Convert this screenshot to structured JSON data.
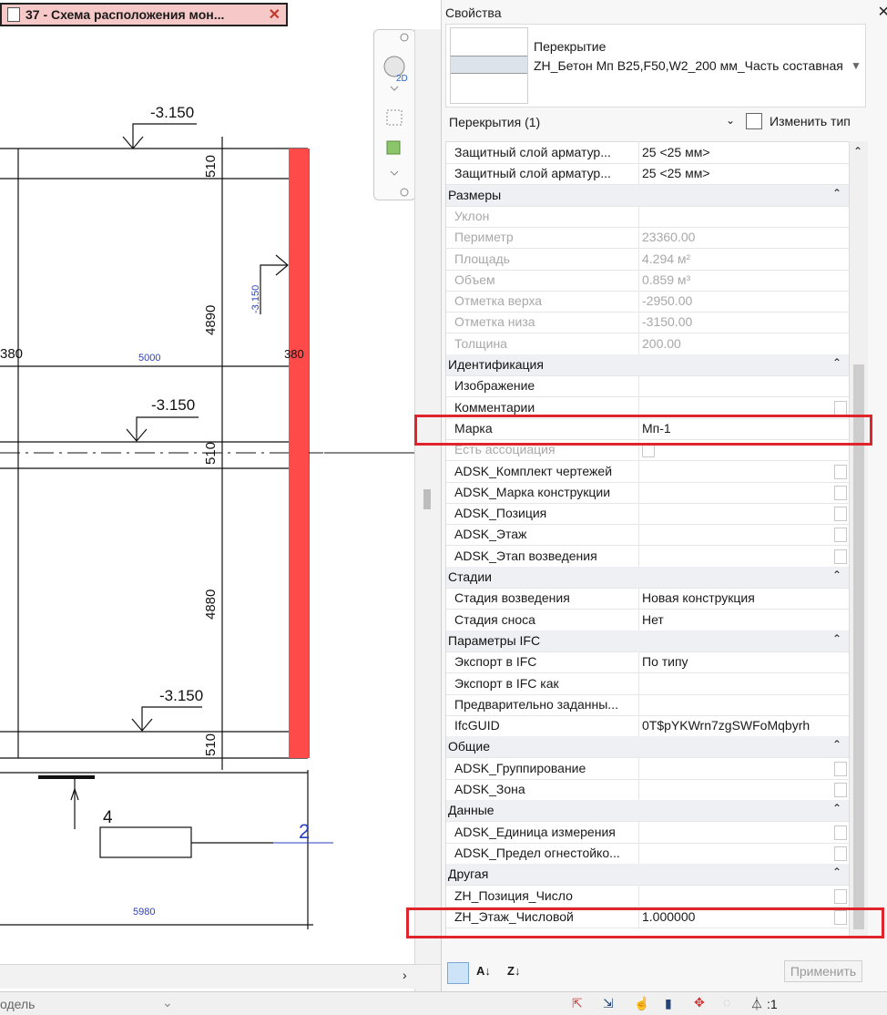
{
  "doc_tab": {
    "title": "37 - Схема расположения мон...",
    "close": "✕"
  },
  "drawing": {
    "elevation_labels": [
      "-3.150",
      "-3.150",
      "-3.150"
    ],
    "vertical_elev": "-3.150",
    "dims": [
      "510",
      "4890",
      "510",
      "4880",
      "510"
    ],
    "dim_blue": [
      "5000",
      "5980"
    ],
    "side_dims": [
      "380",
      "380"
    ],
    "tag_number": "4",
    "marker": "2"
  },
  "props": {
    "title": "Свойства",
    "close": "✕",
    "type_line1": "Перекрытие",
    "type_line2": "ZH_Бетон Мп В25,F50,W2_200 мм_Часть составная",
    "filter_label": "Перекрытия (1)",
    "edit_type": "Изменить тип",
    "apply": "Применить",
    "rows": [
      {
        "kind": "param",
        "label": "Защитный слой арматур...",
        "value": "25 <25 мм>"
      },
      {
        "kind": "param",
        "label": "Защитный слой арматур...",
        "value": "25 <25 мм>"
      },
      {
        "kind": "group",
        "label": "Размеры"
      },
      {
        "kind": "dim",
        "label": "Уклон",
        "value": ""
      },
      {
        "kind": "dim",
        "label": "Периметр",
        "value": "23360.00"
      },
      {
        "kind": "dim",
        "label": "Площадь",
        "value": "4.294 м²"
      },
      {
        "kind": "dim",
        "label": "Объем",
        "value": "0.859 м³"
      },
      {
        "kind": "dim",
        "label": "Отметка верха",
        "value": "-2950.00"
      },
      {
        "kind": "dim",
        "label": "Отметка низа",
        "value": "-3150.00"
      },
      {
        "kind": "dim",
        "label": "Толщина",
        "value": "200.00"
      },
      {
        "kind": "group",
        "label": "Идентификация"
      },
      {
        "kind": "param",
        "label": "Изображение",
        "value": ""
      },
      {
        "kind": "cb",
        "label": "Комментарии",
        "value": ""
      },
      {
        "kind": "param",
        "label": "Марка",
        "value": "Мп-1"
      },
      {
        "kind": "dimcb",
        "label": "Есть ассоциация",
        "value": ""
      },
      {
        "kind": "cb",
        "label": "ADSK_Комплект чертежей",
        "value": ""
      },
      {
        "kind": "cb",
        "label": "ADSK_Марка конструкции",
        "value": ""
      },
      {
        "kind": "cb",
        "label": "ADSK_Позиция",
        "value": ""
      },
      {
        "kind": "cb",
        "label": "ADSK_Этаж",
        "value": ""
      },
      {
        "kind": "cb",
        "label": "ADSK_Этап возведения",
        "value": ""
      },
      {
        "kind": "group",
        "label": "Стадии"
      },
      {
        "kind": "param",
        "label": "Стадия возведения",
        "value": "Новая конструкция"
      },
      {
        "kind": "param",
        "label": "Стадия сноса",
        "value": "Нет"
      },
      {
        "kind": "group",
        "label": "Параметры IFC"
      },
      {
        "kind": "param",
        "label": "Экспорт в IFC",
        "value": "По типу"
      },
      {
        "kind": "param",
        "label": "Экспорт в IFC как",
        "value": ""
      },
      {
        "kind": "param",
        "label": "Предварительно заданны...",
        "value": ""
      },
      {
        "kind": "param",
        "label": "IfcGUID",
        "value": "0T$pYKWrn7zgSWFoMqbyrh"
      },
      {
        "kind": "group",
        "label": "Общие"
      },
      {
        "kind": "cb",
        "label": "ADSK_Группирование",
        "value": ""
      },
      {
        "kind": "cb",
        "label": "ADSK_Зона",
        "value": ""
      },
      {
        "kind": "group",
        "label": "Данные"
      },
      {
        "kind": "cb",
        "label": "ADSK_Единица измерения",
        "value": ""
      },
      {
        "kind": "cb",
        "label": "ADSK_Предел огнестойко...",
        "value": ""
      },
      {
        "kind": "group",
        "label": "Другая"
      },
      {
        "kind": "cb",
        "label": "ZH_Позиция_Число",
        "value": ""
      },
      {
        "kind": "cb",
        "label": "ZH_Этаж_Числовой",
        "value": "1.000000"
      }
    ]
  },
  "status": {
    "model_label": "одель",
    "filter_count": ":1"
  },
  "colors": {
    "highlight": "#e0242b",
    "red_slab": "#ff4a4a",
    "blue_text": "#2a3fbf"
  }
}
